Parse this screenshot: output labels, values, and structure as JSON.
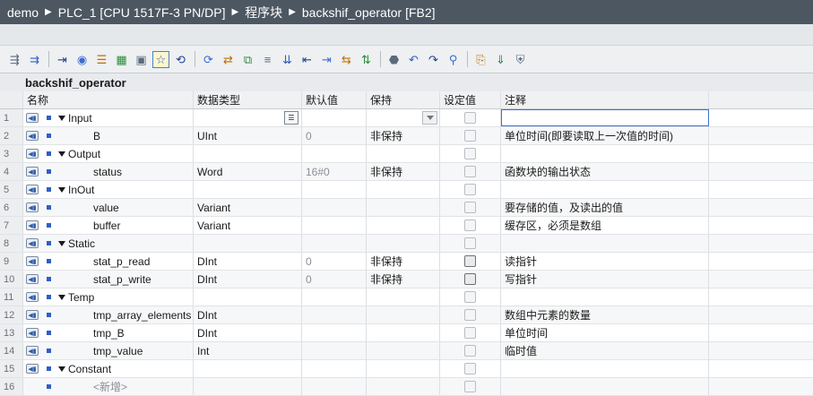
{
  "breadcrumb": [
    "demo",
    "PLC_1 [CPU 1517F-3 PN/DP]",
    "程序块",
    "backshif_operator [FB2]"
  ],
  "toolbar_icons": [
    "insert-row-icon",
    "add-row-icon",
    "export-icon",
    "database-icon",
    "list-icon",
    "grid-icon",
    "monitor-icon",
    "snapshot-icon",
    "watch-icon",
    "reset-icon",
    "move-icon",
    "copy-values-icon",
    "filter-icon",
    "expand-icon",
    "indent-icon",
    "outdent-icon",
    "hierarchy-icon",
    "branch-icon",
    "breakpoint-icon",
    "undo-icon",
    "redo-icon",
    "search-icon",
    "compile-icon",
    "download-icon",
    "safety-icon"
  ],
  "block_name": "backshif_operator",
  "columns": {
    "name": "名称",
    "type": "数据类型",
    "default": "默认值",
    "retain": "保持",
    "setpoint": "设定值",
    "comment": "注释"
  },
  "rows": [
    {
      "num": "1",
      "kind": "section",
      "name": "Input",
      "type": "",
      "default": "",
      "retain": "",
      "comment": "",
      "setpoint_style": "light"
    },
    {
      "num": "2",
      "kind": "var",
      "name": "B",
      "type": "UInt",
      "default": "0",
      "retain": "非保持",
      "comment": "单位时间(即要读取上一次值的时间)",
      "setpoint_style": "light"
    },
    {
      "num": "3",
      "kind": "section",
      "name": "Output",
      "type": "",
      "default": "",
      "retain": "",
      "comment": "",
      "setpoint_style": "light"
    },
    {
      "num": "4",
      "kind": "var",
      "name": "status",
      "type": "Word",
      "default": "16#0",
      "retain": "非保持",
      "comment": "函数块的输出状态",
      "setpoint_style": "light"
    },
    {
      "num": "5",
      "kind": "section",
      "name": "InOut",
      "type": "",
      "default": "",
      "retain": "",
      "comment": "",
      "setpoint_style": "light"
    },
    {
      "num": "6",
      "kind": "var",
      "name": "value",
      "type": "Variant",
      "default": "",
      "retain": "",
      "comment": "要存储的值，及读出的值",
      "setpoint_style": "light"
    },
    {
      "num": "7",
      "kind": "var",
      "name": "buffer",
      "type": "Variant",
      "default": "",
      "retain": "",
      "comment": "缓存区，必须是数组",
      "setpoint_style": "light"
    },
    {
      "num": "8",
      "kind": "section",
      "name": "Static",
      "type": "",
      "default": "",
      "retain": "",
      "comment": "",
      "setpoint_style": "light"
    },
    {
      "num": "9",
      "kind": "var",
      "name": "stat_p_read",
      "type": "DInt",
      "default": "0",
      "retain": "非保持",
      "comment": "读指针",
      "setpoint_style": "dark"
    },
    {
      "num": "10",
      "kind": "var",
      "name": "stat_p_write",
      "type": "DInt",
      "default": "0",
      "retain": "非保持",
      "comment": "写指针",
      "setpoint_style": "dark"
    },
    {
      "num": "11",
      "kind": "section",
      "name": "Temp",
      "type": "",
      "default": "",
      "retain": "",
      "comment": "",
      "setpoint_style": "light"
    },
    {
      "num": "12",
      "kind": "var",
      "name": "tmp_array_elements",
      "type": "DInt",
      "default": "",
      "retain": "",
      "comment": "数组中元素的数量",
      "setpoint_style": "light"
    },
    {
      "num": "13",
      "kind": "var",
      "name": "tmp_B",
      "type": "DInt",
      "default": "",
      "retain": "",
      "comment": "单位时间",
      "setpoint_style": "light"
    },
    {
      "num": "14",
      "kind": "var",
      "name": "tmp_value",
      "type": "Int",
      "default": "",
      "retain": "",
      "comment": "临时值",
      "setpoint_style": "light"
    },
    {
      "num": "15",
      "kind": "section",
      "name": "Constant",
      "type": "",
      "default": "",
      "retain": "",
      "comment": "",
      "setpoint_style": "light"
    },
    {
      "num": "16",
      "kind": "add",
      "name": "<新增>",
      "type": "",
      "default": "",
      "retain": "",
      "comment": "",
      "setpoint_style": "light"
    }
  ],
  "colors": {
    "titlebar": "#4c5761",
    "param_icon": "#2f5fc4",
    "selection": "#3b6fd6"
  }
}
